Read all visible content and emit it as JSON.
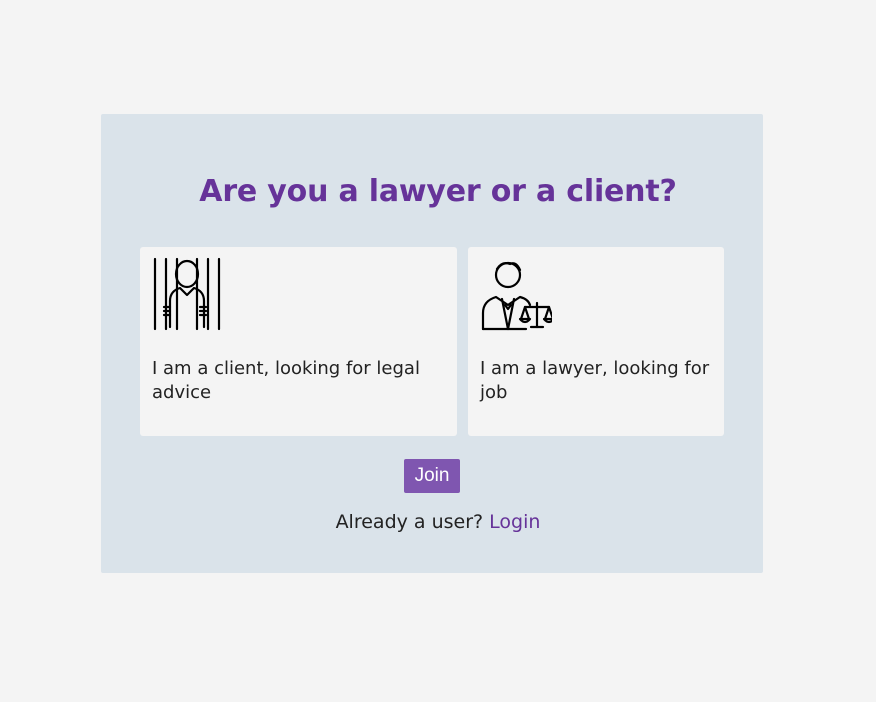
{
  "heading": "Are you a lawyer or a client?",
  "cards": [
    {
      "label": "I am a client, looking for legal advice",
      "icon": "prisoner-icon"
    },
    {
      "label": "I am a lawyer, looking for job",
      "icon": "lawyer-scales-icon"
    }
  ],
  "join_label": "Join",
  "already_text": "Already a user?",
  "login_label": "Login",
  "colors": {
    "accent": "#663399",
    "button": "#7f56b0",
    "panel": "#dae3ea",
    "background": "#f4f4f4"
  }
}
